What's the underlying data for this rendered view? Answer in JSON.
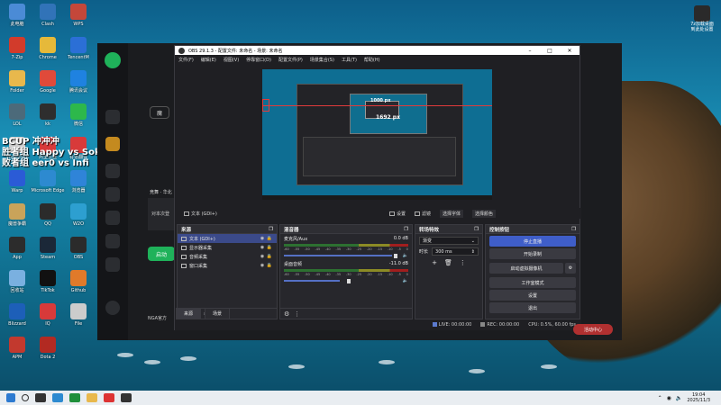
{
  "desktop": {
    "icons": [
      {
        "label": "此电脑",
        "color": "#4b8bd6"
      },
      {
        "label": "7-Zip",
        "color": "#d23b2b"
      },
      {
        "label": "Folder",
        "color": "#e8b84c"
      },
      {
        "label": "LOL",
        "color": "#4c6a7a"
      },
      {
        "label": "StoredSke",
        "color": "#d0d0d0"
      },
      {
        "label": "Warp",
        "color": "#2b5bd6"
      },
      {
        "label": "魔兽争霸",
        "color": "#c9a35a"
      },
      {
        "label": "App",
        "color": "#2c2c2c"
      },
      {
        "label": "回收站",
        "color": "#7ab0e0"
      },
      {
        "label": "Blizzard",
        "color": "#1d5fb8"
      },
      {
        "label": "APM",
        "color": "#c2392e"
      },
      {
        "label": "Clash",
        "color": "#3173b8"
      },
      {
        "label": "Chrome",
        "color": "#e6b93a"
      },
      {
        "label": "Google",
        "color": "#e04a3a"
      },
      {
        "label": "kk",
        "color": "#2e2e2e"
      },
      {
        "label": "阿里云盘",
        "color": "#d83a3a"
      },
      {
        "label": "Microsoft Edge",
        "color": "#2d8ad0"
      },
      {
        "label": "QQ",
        "color": "#2b2b2b"
      },
      {
        "label": "Steam",
        "color": "#1b2838"
      },
      {
        "label": "TikTok",
        "color": "#111111"
      },
      {
        "label": "IQ",
        "color": "#d83a3a"
      },
      {
        "label": "Dota 2",
        "color": "#b22a22"
      },
      {
        "label": "WPS",
        "color": "#c4473a"
      },
      {
        "label": "TencentM",
        "color": "#2b6fd6"
      },
      {
        "label": "腾讯会议",
        "color": "#1f82e0"
      },
      {
        "label": "微信",
        "color": "#2db84b"
      },
      {
        "label": "有道翻译",
        "color": "#d83a3a"
      },
      {
        "label": "浏览器",
        "color": "#2f84d8"
      },
      {
        "label": "W2O",
        "color": "#2d9fd0"
      },
      {
        "label": "OBS",
        "color": "#2b2b2b"
      },
      {
        "label": "Github",
        "color": "#e07a2a"
      },
      {
        "label": "File",
        "color": "#ccc"
      }
    ],
    "overlay_lines": [
      "BCUP 冲冲冲",
      "胜者组 Happy vs Sok",
      "败者组 eer0 vs Infi"
    ],
    "right_icon_label": "7z加载桌面到此处设置"
  },
  "launcher": {
    "title_btn": "魔",
    "game_section": "竞舞 · 华北",
    "text1": "对本次登",
    "button_start": "启动",
    "footer_label": "NGA官方"
  },
  "obs": {
    "window_title": "OBS 29.1.3 - 配置文件: 未命名 - 场景: 未命名",
    "menu": [
      "文件(F)",
      "编辑(E)",
      "视图(V)",
      "停靠窗口(D)",
      "配置文件(P)",
      "场景集合(S)",
      "工具(T)",
      "帮助(H)"
    ],
    "preview_px_label": "1692 px",
    "preview_px_label2": "1000 px",
    "source_bar": {
      "name": "文本 (GDI+)",
      "properties": "设置",
      "filters": "滤镜",
      "edit_text": "选择字体",
      "color": "选择颜色"
    },
    "sources": {
      "title": "来源",
      "items": [
        "文本 (GDI+)",
        "显示器采集",
        "音频采集",
        "窗口采集"
      ]
    },
    "mixer": {
      "title": "混音器",
      "tracks": [
        {
          "name": "麦克风/Aux",
          "db": "0.0 dB"
        },
        {
          "name": "桌面音频",
          "db": "-11.0 dB"
        }
      ],
      "scale": [
        "-60",
        "-55",
        "-50",
        "-45",
        "-40",
        "-35",
        "-30",
        "-25",
        "-20",
        "-15",
        "-10",
        "-5",
        "0"
      ]
    },
    "transitions": {
      "title": "转场特效",
      "type": "渐变",
      "duration_label": "时长",
      "duration": "300 ms"
    },
    "controls": {
      "title": "控制按钮",
      "buttons": [
        "停止直播",
        "开始录制",
        "启动虚拟摄像机",
        "工作室模式",
        "设置",
        "退出"
      ]
    },
    "scene_tabs": [
      "来源",
      "场景"
    ],
    "status": {
      "live": "LIVE: 00:00:00",
      "rec": "REC: 00:00:00",
      "cpu": "CPU: 0.5%, 60.00 fps"
    },
    "corner_badge": "活动中心"
  },
  "taskbar": {
    "time": "19:04",
    "date": "2025/11/3"
  }
}
